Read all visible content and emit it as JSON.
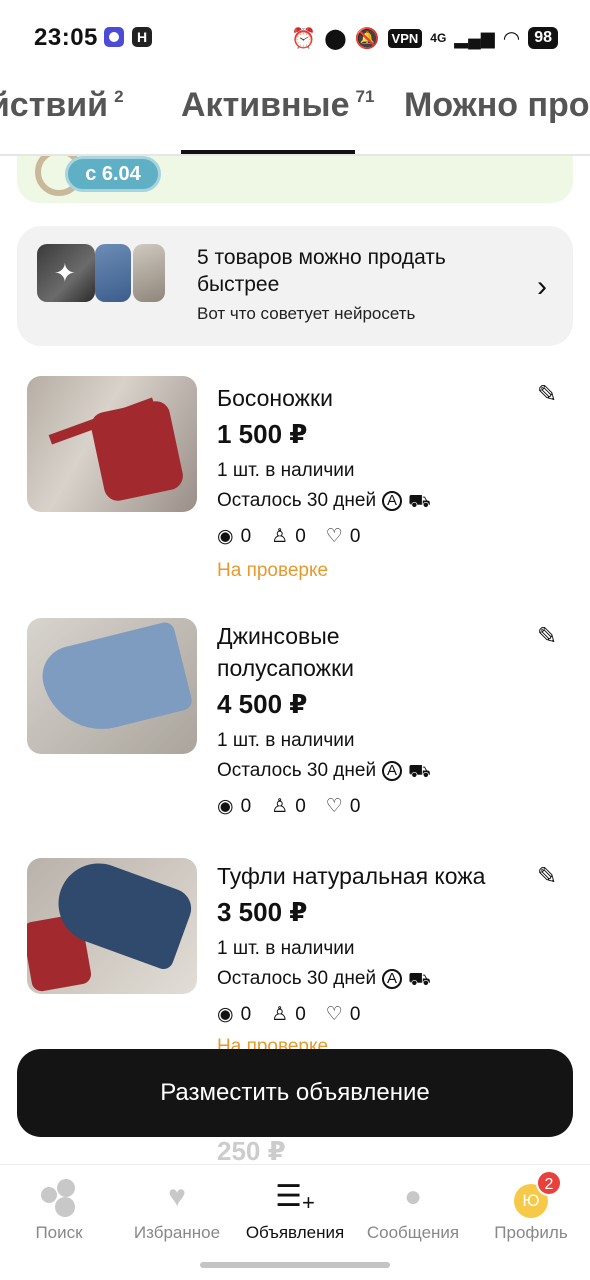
{
  "status_bar": {
    "time": "23:05",
    "vpn": "VPN",
    "network": "4G",
    "battery": "98"
  },
  "tabs": [
    {
      "label": "ействий",
      "count": "2"
    },
    {
      "label": "Активные",
      "count": "71",
      "active": true
    },
    {
      "label": "Можно про",
      "count": ""
    }
  ],
  "banner": {
    "pill_text": "с 6.04"
  },
  "ai_card": {
    "title": "5 товаров можно продать быстрее",
    "subtitle": "Вот что советует нейросеть",
    "chevron": "›"
  },
  "listings": [
    {
      "name": "Босоножки",
      "price": "1 500 ₽",
      "stock": "1 шт. в наличии",
      "days": "Осталось 30 дней",
      "views": "0",
      "contacts": "0",
      "likes": "0",
      "status": "На проверке"
    },
    {
      "name": "Джинсовые полусапожки",
      "price": "4 500 ₽",
      "stock": "1 шт. в наличии",
      "days": "Осталось 30 дней",
      "views": "0",
      "contacts": "0",
      "likes": "0"
    },
    {
      "name": "Туфли натуральная кожа",
      "price": "3 500 ₽",
      "stock": "1 шт. в наличии",
      "days": "Осталось 30 дней",
      "views": "0",
      "contacts": "0",
      "likes": "0",
      "status": "На проверке"
    }
  ],
  "peek_price": "250 ₽",
  "place_button": "Разместить объявление",
  "bottom_nav": [
    {
      "label": "Поиск",
      "icon": "search-dots-icon"
    },
    {
      "label": "Избранное",
      "icon": "heart-icon"
    },
    {
      "label": "Объявления",
      "icon": "listings-add-icon",
      "active": true
    },
    {
      "label": "Сообщения",
      "icon": "chat-bubble-icon"
    },
    {
      "label": "Профиль",
      "icon": "avatar-icon",
      "avatar_letter": "Ю",
      "badge": "2"
    }
  ],
  "colors": {
    "accent_status": "#e69a2e",
    "button_bg": "#141414",
    "badge": "#e8413c"
  }
}
